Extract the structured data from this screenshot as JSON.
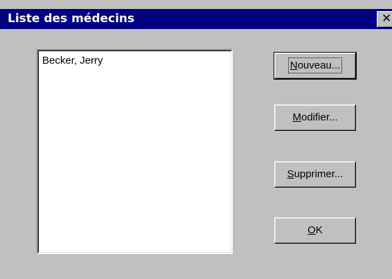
{
  "window": {
    "title": "Liste des médecins",
    "close_symbol": "✕",
    "close_icon": "close-icon"
  },
  "list": {
    "items": [
      {
        "label": "Becker, Jerry"
      }
    ]
  },
  "buttons": {
    "new": {
      "mnemonic": "N",
      "rest": "ouveau..."
    },
    "modify": {
      "mnemonic": "M",
      "rest": "odifier..."
    },
    "delete": {
      "mnemonic": "S",
      "rest": "upprimer..."
    },
    "ok": {
      "mnemonic": "O",
      "rest": "K"
    }
  },
  "colors": {
    "titlebar": "#000080",
    "face": "#c0c0c0",
    "list_bg": "#ffffff"
  }
}
